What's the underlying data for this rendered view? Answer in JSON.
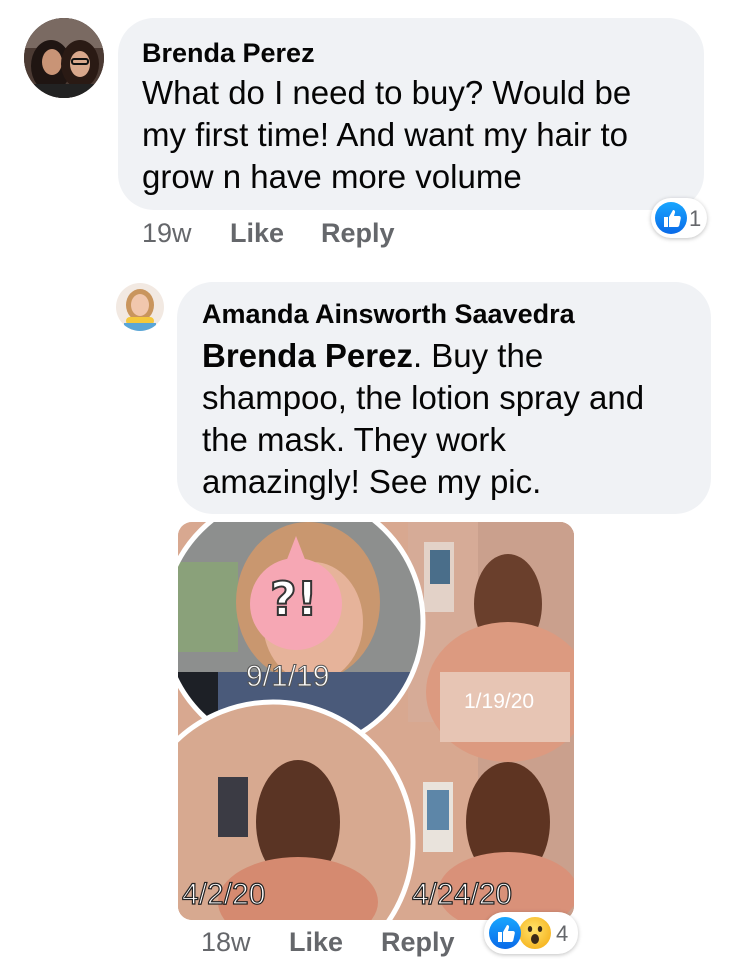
{
  "comment": {
    "author": "Brenda Perez",
    "text_lines": [
      "What do I need to buy? Would be",
      "my first time! And want my hair to",
      "grow n have more volume"
    ],
    "time": "19w",
    "like_label": "Like",
    "reply_label": "Reply",
    "reaction_count": "1",
    "reaction_icons": [
      "like-icon"
    ]
  },
  "reply": {
    "author": "Amanda Ainsworth Saavedra",
    "mention": "Brenda Perez",
    "text_lines": [
      ". Buy the",
      "shampoo, the lotion spray and",
      "the mask. They work",
      "amazingly! See my pic."
    ],
    "photo": {
      "sticker_text": "?!",
      "dates": [
        "9/1/19",
        "1/19/20",
        "4/2/20",
        "4/24/20"
      ]
    },
    "time": "18w",
    "like_label": "Like",
    "reply_label": "Reply",
    "reaction_count": "4",
    "reaction_icons": [
      "like-icon",
      "wow-icon"
    ]
  },
  "colors": {
    "bubble": "#f0f2f5",
    "meta_text": "#65676b",
    "like_blue": "#1877f2"
  }
}
